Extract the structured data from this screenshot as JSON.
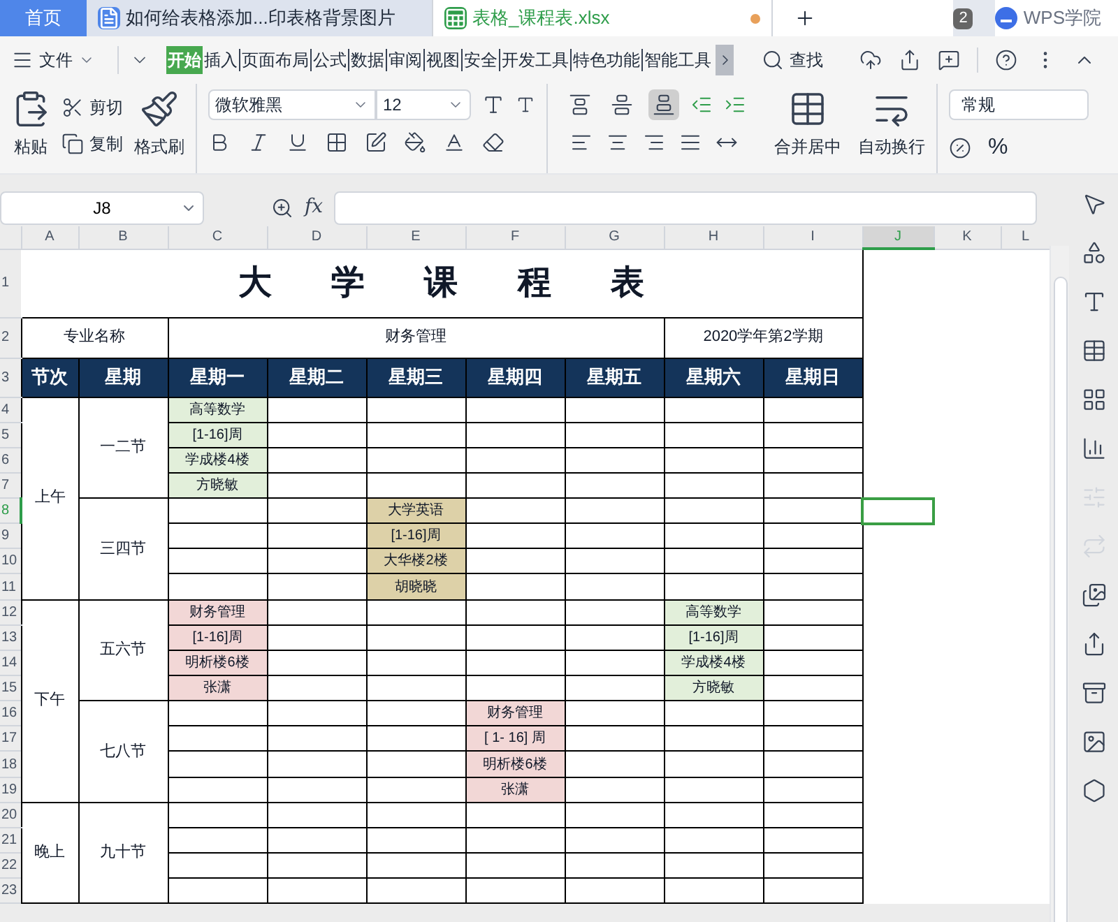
{
  "tabs": [
    {
      "kind": "home",
      "label": "首页",
      "selected": false,
      "modified": false
    },
    {
      "kind": "doc",
      "label": "如何给表格添加...印表格背景图片",
      "selected": false,
      "modified": false
    },
    {
      "kind": "sheet",
      "label": "表格_课程表.xlsx",
      "selected": true,
      "modified": true
    }
  ],
  "window_count": "2",
  "account": "WPS学院",
  "menu": {
    "file": "文件",
    "ribbon_tabs": [
      {
        "label": "开始",
        "selected": true
      },
      {
        "label": "插入",
        "selected": false
      },
      {
        "label": "页面布局",
        "selected": false
      },
      {
        "label": "公式",
        "selected": false
      },
      {
        "label": "数据",
        "selected": false
      },
      {
        "label": "审阅",
        "selected": false
      },
      {
        "label": "视图",
        "selected": false
      },
      {
        "label": "安全",
        "selected": false
      },
      {
        "label": "开发工具",
        "selected": false
      },
      {
        "label": "特色功能",
        "selected": false
      },
      {
        "label": "智能工具",
        "selected": false
      }
    ],
    "find": "查找"
  },
  "toolbar": {
    "paste": "粘贴",
    "cut": "剪切",
    "copy": "复制",
    "format_painter": "格式刷",
    "font": "微软雅黑",
    "font_size": "12",
    "vertical_align": [
      {
        "kind": "top",
        "selected": false
      },
      {
        "kind": "middle",
        "selected": false
      },
      {
        "kind": "bottom",
        "selected": true
      }
    ],
    "merge": "合并居中",
    "wrap": "自动换行",
    "number_format": "常规",
    "percent": "%"
  },
  "formula_bar": {
    "name_box": "J8",
    "fx": "fx"
  },
  "columns": [
    {
      "label": "A",
      "selected": false
    },
    {
      "label": "B",
      "selected": false
    },
    {
      "label": "C",
      "selected": false
    },
    {
      "label": "D",
      "selected": false
    },
    {
      "label": "E",
      "selected": false
    },
    {
      "label": "F",
      "selected": false
    },
    {
      "label": "G",
      "selected": false
    },
    {
      "label": "H",
      "selected": false
    },
    {
      "label": "I",
      "selected": false
    },
    {
      "label": "J",
      "selected": true
    },
    {
      "label": "K",
      "selected": false
    },
    {
      "label": "L",
      "selected": false
    }
  ],
  "row_numbers": [
    {
      "label": "1",
      "selected": false
    },
    {
      "label": "2",
      "selected": false
    },
    {
      "label": "3",
      "selected": false
    },
    {
      "label": "4",
      "selected": false
    },
    {
      "label": "5",
      "selected": false
    },
    {
      "label": "6",
      "selected": false
    },
    {
      "label": "7",
      "selected": false
    },
    {
      "label": "8",
      "selected": true
    },
    {
      "label": "9",
      "selected": false
    },
    {
      "label": "10",
      "selected": false
    },
    {
      "label": "11",
      "selected": false
    },
    {
      "label": "12",
      "selected": false
    },
    {
      "label": "13",
      "selected": false
    },
    {
      "label": "14",
      "selected": false
    },
    {
      "label": "15",
      "selected": false
    },
    {
      "label": "16",
      "selected": false
    },
    {
      "label": "17",
      "selected": false
    },
    {
      "label": "18",
      "selected": false
    },
    {
      "label": "19",
      "selected": false
    },
    {
      "label": "20",
      "selected": false
    },
    {
      "label": "21",
      "selected": false
    },
    {
      "label": "22",
      "selected": false
    },
    {
      "label": "23",
      "selected": false
    }
  ],
  "sheet": {
    "title": "大 学 课 程 表",
    "major_label": "专业名称",
    "major": "财务管理",
    "term": "2020学年第2学期",
    "headers": [
      "节次",
      "星期",
      "星期一",
      "星期二",
      "星期三",
      "星期四",
      "星期五",
      "星期六",
      "星期日"
    ],
    "sections": [
      {
        "label": "上午",
        "slots": [
          {
            "label": "一二节",
            "days": [
              {
                "kind": "course",
                "color": "#e2efda",
                "lines": [
                  "高等数学",
                  "[1-16]周",
                  "学成楼4楼",
                  "方晓敏"
                ]
              },
              {
                "kind": "empty"
              },
              {
                "kind": "empty"
              },
              {
                "kind": "empty"
              },
              {
                "kind": "empty"
              },
              {
                "kind": "empty"
              },
              {
                "kind": "empty"
              }
            ]
          },
          {
            "label": "三四节",
            "days": [
              {
                "kind": "empty"
              },
              {
                "kind": "empty"
              },
              {
                "kind": "course",
                "color": "#ddd1a8",
                "lines": [
                  "大学英语",
                  "[1-16]周",
                  "大华楼2楼",
                  "胡晓晓"
                ]
              },
              {
                "kind": "empty"
              },
              {
                "kind": "empty"
              },
              {
                "kind": "empty"
              },
              {
                "kind": "empty"
              }
            ]
          }
        ]
      },
      {
        "label": "下午",
        "slots": [
          {
            "label": "五六节",
            "days": [
              {
                "kind": "course",
                "color": "#f2d7d6",
                "lines": [
                  "财务管理",
                  "[1-16]周",
                  "明析楼6楼",
                  "张潇"
                ]
              },
              {
                "kind": "empty"
              },
              {
                "kind": "empty"
              },
              {
                "kind": "empty"
              },
              {
                "kind": "empty"
              },
              {
                "kind": "course",
                "color": "#e2efda",
                "lines": [
                  "高等数学",
                  "[1-16]周",
                  "学成楼4楼",
                  "方晓敏"
                ]
              },
              {
                "kind": "empty"
              }
            ]
          },
          {
            "label": "七八节",
            "days": [
              {
                "kind": "empty"
              },
              {
                "kind": "empty"
              },
              {
                "kind": "empty"
              },
              {
                "kind": "course",
                "color": "#f2d7d6",
                "lines": [
                  "财务管理",
                  "[ 1- 16] 周",
                  "明析楼6楼",
                  "张潇"
                ]
              },
              {
                "kind": "empty"
              },
              {
                "kind": "empty"
              },
              {
                "kind": "empty"
              }
            ]
          }
        ]
      },
      {
        "label": "晚上",
        "slots": [
          {
            "label": "九十节",
            "days": [
              {
                "kind": "empty"
              },
              {
                "kind": "empty"
              },
              {
                "kind": "empty"
              },
              {
                "kind": "empty"
              },
              {
                "kind": "empty"
              },
              {
                "kind": "empty"
              },
              {
                "kind": "empty"
              }
            ]
          }
        ]
      }
    ]
  },
  "side_tools": [
    {
      "kind": "pointer",
      "disabled": false
    },
    {
      "kind": "shapes",
      "disabled": false
    },
    {
      "kind": "text",
      "disabled": false
    },
    {
      "kind": "table",
      "disabled": false
    },
    {
      "kind": "grid",
      "disabled": false
    },
    {
      "kind": "chart",
      "disabled": false
    },
    {
      "kind": "sliders",
      "disabled": true
    },
    {
      "kind": "repeat",
      "disabled": true
    },
    {
      "kind": "images",
      "disabled": false
    },
    {
      "kind": "share",
      "disabled": false
    },
    {
      "kind": "archive",
      "disabled": false
    },
    {
      "kind": "image",
      "disabled": false
    },
    {
      "kind": "hexagon",
      "disabled": false
    }
  ]
}
